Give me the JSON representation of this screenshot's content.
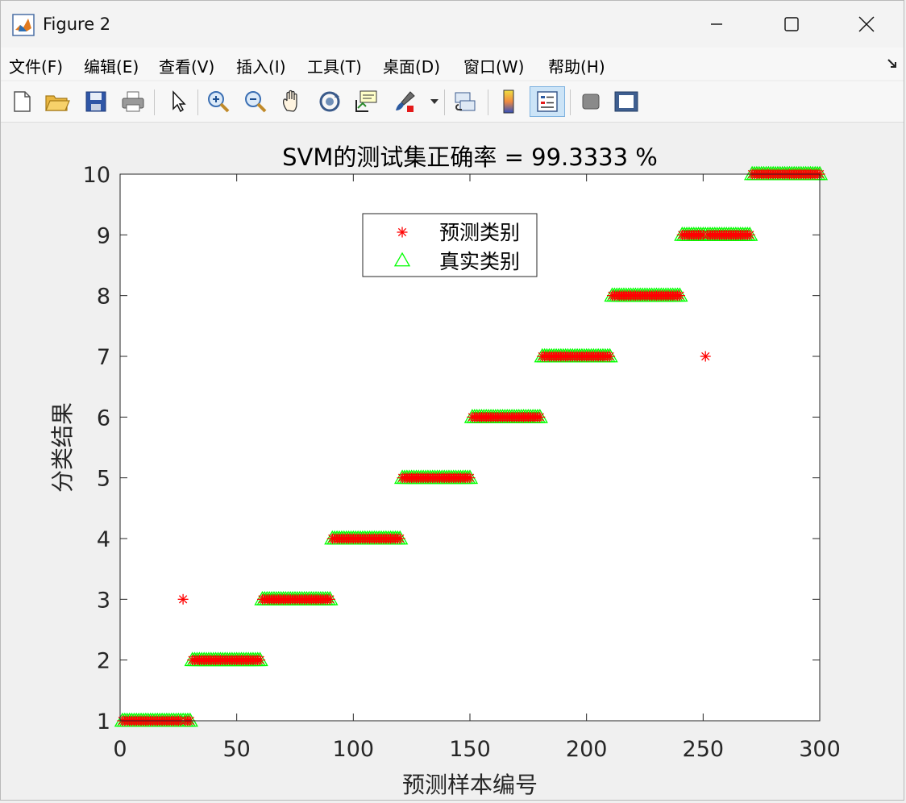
{
  "window": {
    "title": "Figure 2"
  },
  "menu": {
    "items": [
      "文件(F)",
      "编辑(E)",
      "查看(V)",
      "插入(I)",
      "工具(T)",
      "桌面(D)",
      "窗口(W)",
      "帮助(H)"
    ],
    "underline": [
      "F",
      "E",
      "V",
      "I",
      "T",
      "D",
      "W",
      "H"
    ]
  },
  "toolbar": {
    "icons": [
      "new-figure-icon",
      "open-file-icon",
      "save-icon",
      "print-icon",
      "pointer-icon",
      "zoom-in-icon",
      "zoom-out-icon",
      "pan-hand-icon",
      "rotate-3d-icon",
      "data-cursor-icon",
      "brush-icon",
      "link-plot-icon",
      "colorbar-icon",
      "legend-icon",
      "hide-plot-tools-icon",
      "show-plot-tools-icon"
    ]
  },
  "colors": {
    "predicted": "#ff0000",
    "actual": "#00ff00",
    "background": "#f0f0f0",
    "axes_bg": "#ffffff"
  },
  "chart_data": {
    "type": "scatter",
    "title": "SVM的测试集正确率 = 99.3333 %",
    "xlabel": "预测样本编号",
    "ylabel": "分类结果",
    "xlim": [
      0,
      300
    ],
    "ylim": [
      1,
      10
    ],
    "xticks": [
      0,
      50,
      100,
      150,
      200,
      250,
      300
    ],
    "yticks": [
      1,
      2,
      3,
      4,
      5,
      6,
      7,
      8,
      9,
      10
    ],
    "legend": {
      "placement": "top-center",
      "entries": [
        {
          "label": "预测类别",
          "marker": "asterisk",
          "color": "#ff0000"
        },
        {
          "label": "真实类别",
          "marker": "triangle",
          "color": "#00ff00"
        }
      ]
    },
    "classes": [
      {
        "class": 1,
        "x_start": 1,
        "x_end": 30
      },
      {
        "class": 2,
        "x_start": 31,
        "x_end": 60
      },
      {
        "class": 3,
        "x_start": 61,
        "x_end": 90
      },
      {
        "class": 4,
        "x_start": 91,
        "x_end": 120
      },
      {
        "class": 5,
        "x_start": 121,
        "x_end": 150
      },
      {
        "class": 6,
        "x_start": 151,
        "x_end": 180
      },
      {
        "class": 7,
        "x_start": 181,
        "x_end": 210
      },
      {
        "class": 8,
        "x_start": 211,
        "x_end": 240
      },
      {
        "class": 9,
        "x_start": 241,
        "x_end": 270
      },
      {
        "class": 10,
        "x_start": 271,
        "x_end": 300
      }
    ],
    "misclassified": [
      {
        "x": 27,
        "actual": 1,
        "predicted": 3
      },
      {
        "x": 251,
        "actual": 9,
        "predicted": 7
      }
    ]
  }
}
